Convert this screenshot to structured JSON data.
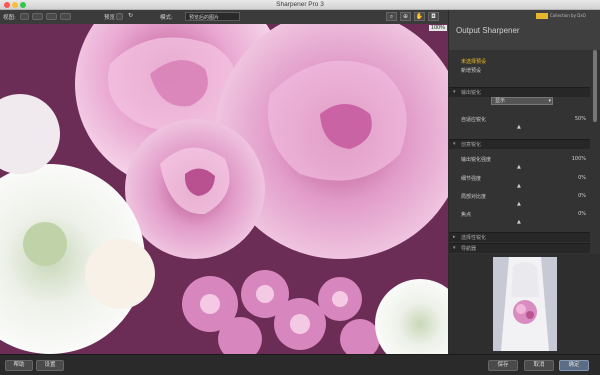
{
  "window": {
    "title": "Sharpener Pro 3"
  },
  "toolbar": {
    "view_label": "视图:",
    "preview_label": "预览",
    "mode_label": "模式:",
    "mode_value": "预览后的图片"
  },
  "preview": {
    "zoom": "100%"
  },
  "side": {
    "title": "Output Sharpener",
    "brand": "Collection by DxO",
    "presets": {
      "active": "未选择预设",
      "new": "新增预设"
    },
    "section_output": "输出锐化",
    "dropdown_value": "显示",
    "adaptive_label": "自适应锐化",
    "adaptive_value": "50%",
    "section_creative": "创意锐化",
    "output_strength_label": "输出锐化强度",
    "output_strength_value": "100%",
    "structure_label": "细节强度",
    "structure_value": "0%",
    "local_contrast_label": "局部对比度",
    "local_contrast_value": "0%",
    "focus_label": "焦点",
    "focus_value": "0%",
    "section_selective": "选择性锐化",
    "section_loupe": "导航器"
  },
  "bottom": {
    "left_btn1": "帮助",
    "left_btn2": "设置",
    "btn_save": "保存",
    "btn_cancel": "取消",
    "btn_ok": "确定"
  },
  "colors": {
    "accent": "#f0c020",
    "primary_button": "#5b6d85"
  }
}
